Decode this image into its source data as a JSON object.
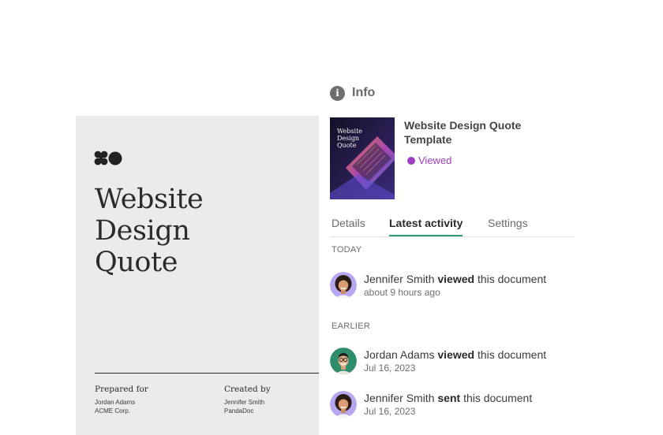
{
  "document_preview": {
    "title_lines": [
      "Website",
      "Design",
      "Quote"
    ],
    "prepared_for": {
      "heading": "Prepared for",
      "name": "Jordan Adams",
      "company": "ACME Corp."
    },
    "created_by": {
      "heading": "Created by",
      "name": "Jennifer Smith",
      "company": "PandaDoc"
    }
  },
  "info_panel": {
    "icon": "info-icon",
    "title": "Info",
    "thumbnail": {
      "title_lines": [
        "Website",
        "Design",
        "Quote"
      ]
    },
    "document_name_lines": [
      "Website Design Quote",
      "Template"
    ],
    "status": {
      "label": "Viewed",
      "color": "#9b3fbf"
    },
    "tabs": [
      {
        "label": "Details",
        "active": false
      },
      {
        "label": "Latest activity",
        "active": true
      },
      {
        "label": "Settings",
        "active": false
      }
    ],
    "accent_color": "#2f9b78",
    "sections": {
      "today": "TODAY",
      "earlier": "EARLIER"
    },
    "activities": [
      {
        "user": "Jennifer Smith",
        "action": "viewed",
        "suffix": "this document",
        "time": "about 9 hours ago",
        "avatar": "avatar-jennifer"
      },
      {
        "user": "Jordan Adams",
        "action": "viewed",
        "suffix": "this document",
        "time": "Jul 16, 2023",
        "avatar": "avatar-jordan"
      },
      {
        "user": "Jennifer Smith",
        "action": "sent",
        "suffix": "this document",
        "time": "Jul 16, 2023",
        "avatar": "avatar-jennifer"
      }
    ]
  }
}
